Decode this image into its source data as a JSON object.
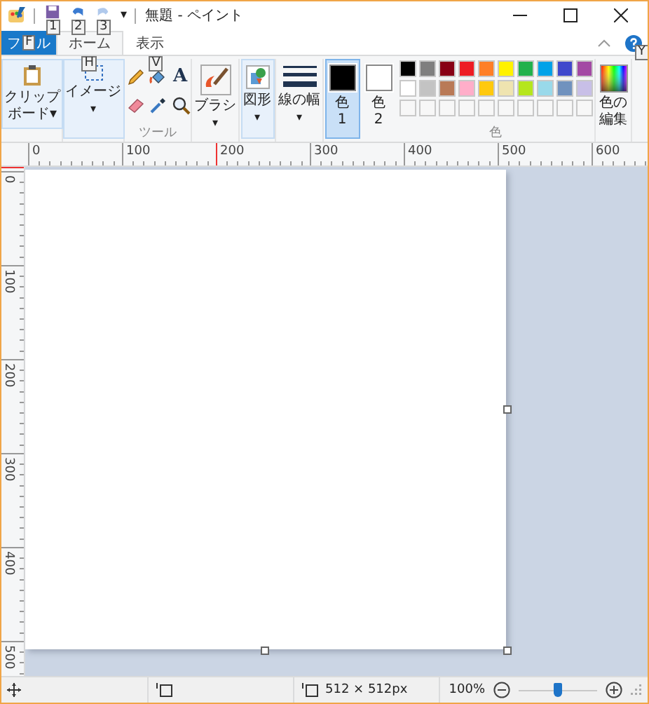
{
  "title_bar": {
    "title": "無題 - ペイント",
    "customize": "▾",
    "quick_access": [
      {
        "kind": "save",
        "keytip": "1",
        "disabled": false
      },
      {
        "kind": "undo",
        "keytip": "2",
        "disabled": false
      },
      {
        "kind": "redo",
        "keytip": "3",
        "disabled": true
      }
    ]
  },
  "tabs": [
    {
      "kind": "file",
      "label_start": "フ",
      "keytip": "F",
      "label_end": "ル",
      "selected": false
    },
    {
      "kind": "normal",
      "label": "ホーム",
      "keytip": "H",
      "selected": true
    },
    {
      "kind": "normal",
      "label": "表示",
      "keytip": "V",
      "selected": false
    }
  ],
  "help_keytip": "Y",
  "ribbon": {
    "clipboard": {
      "lines": [
        "クリップ",
        "ボード▾"
      ]
    },
    "image": {
      "label": "イメージ",
      "caret": "▾"
    },
    "tools": {
      "label": "ツール",
      "text_tool": "A"
    },
    "brushes": {
      "label": "ブラシ",
      "caret": "▾"
    },
    "shapes": {
      "label": "図形",
      "caret": "▾"
    },
    "line_width": {
      "label": "線の幅",
      "caret": "▾"
    },
    "color1": {
      "label": "色",
      "number": "1",
      "color": "#000000",
      "selected": true
    },
    "color2": {
      "label": "色",
      "number": "2",
      "color": "#ffffff",
      "selected": false
    },
    "palette": {
      "label": "色",
      "colors": [
        {
          "color": "#000000"
        },
        {
          "color": "#7f7f7f"
        },
        {
          "color": "#880015"
        },
        {
          "color": "#ed1c24"
        },
        {
          "color": "#ff7f27"
        },
        {
          "color": "#fff200"
        },
        {
          "color": "#22b14c"
        },
        {
          "color": "#00a2e8"
        },
        {
          "color": "#3f48cc"
        },
        {
          "color": "#a349a4"
        },
        {
          "color": "#ffffff"
        },
        {
          "color": "#c3c3c3"
        },
        {
          "color": "#b97a57"
        },
        {
          "color": "#ffaec9"
        },
        {
          "color": "#ffc90e"
        },
        {
          "color": "#efe4b0"
        },
        {
          "color": "#b5e61d"
        },
        {
          "color": "#99d9ea"
        },
        {
          "color": "#7092be"
        },
        {
          "color": "#c8bfe7"
        }
      ]
    },
    "edit_colors": {
      "lines": [
        "色の",
        "編集"
      ]
    }
  },
  "ruler": {
    "horizontal": [
      "0",
      "100",
      "200",
      "300",
      "400",
      "500",
      "600"
    ],
    "vertical": [
      "0",
      "100",
      "200",
      "300",
      "400",
      "500"
    ]
  },
  "status_bar": {
    "size": "512 × 512px",
    "zoom": "100%",
    "zoom_slider": {
      "level": 0.5
    }
  }
}
